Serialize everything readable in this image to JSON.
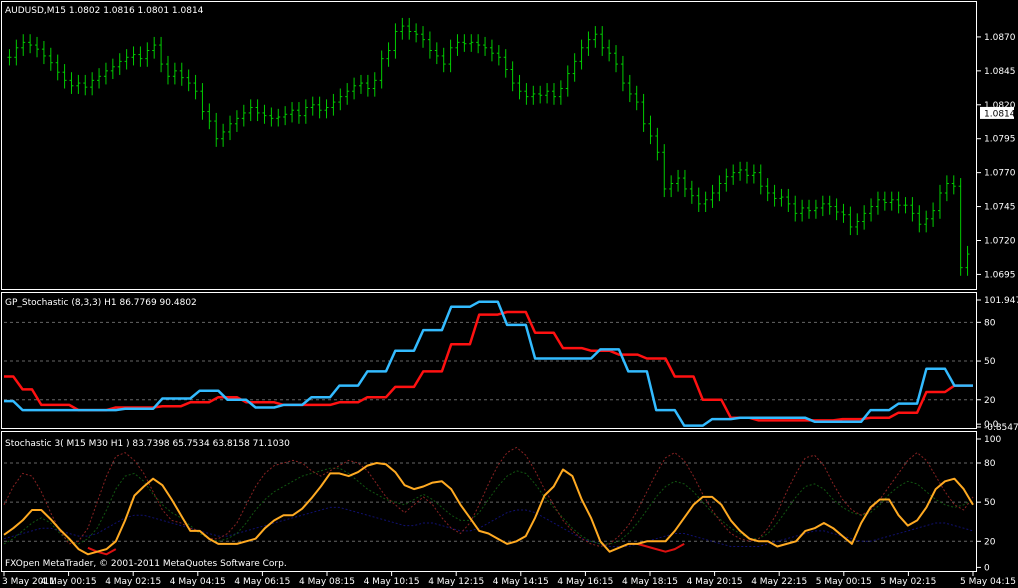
{
  "chart_data": [
    {
      "id": "price",
      "type": "ohlc",
      "title": "AUDUSD,M15  1.0802 1.0816 1.0801 1.0814",
      "ylim": [
        1.0685,
        1.0895
      ],
      "yticks": [
        {
          "value": 1.087,
          "label": "1.0870"
        },
        {
          "value": 1.0845,
          "label": "1.0845"
        },
        {
          "value": 1.082,
          "label": "1.0820"
        },
        {
          "value": 1.0795,
          "label": "1.0795"
        },
        {
          "value": 1.077,
          "label": "1.0770"
        },
        {
          "value": 1.0745,
          "label": "1.0745"
        },
        {
          "value": 1.072,
          "label": "1.0720"
        },
        {
          "value": 1.0695,
          "label": "1.0695"
        }
      ],
      "current_price": {
        "value": 1.0814,
        "label": "1.0814"
      },
      "bar_color": "#00cc00",
      "closes": [
        1.0855,
        1.0862,
        1.0866,
        1.0864,
        1.0861,
        1.0856,
        1.0851,
        1.0844,
        1.0838,
        1.0834,
        1.0836,
        1.0833,
        1.0838,
        1.0841,
        1.0845,
        1.0848,
        1.0852,
        1.0855,
        1.0857,
        1.0854,
        1.086,
        1.0864,
        1.085,
        1.0841,
        1.0845,
        1.084,
        1.0836,
        1.083,
        1.0815,
        1.0808,
        1.0795,
        1.08,
        1.0806,
        1.081,
        1.0814,
        1.0818,
        1.0814,
        1.0812,
        1.081,
        1.0811,
        1.0813,
        1.0816,
        1.0812,
        1.0818,
        1.082,
        1.0816,
        1.0818,
        1.0822,
        1.0826,
        1.083,
        1.0834,
        1.0836,
        1.0832,
        1.0838,
        1.0854,
        1.086,
        1.0874,
        1.0878,
        1.0874,
        1.0872,
        1.0868,
        1.086,
        1.0856,
        1.085,
        1.0862,
        1.0866,
        1.0865,
        1.0866,
        1.0864,
        1.0862,
        1.0858,
        1.0855,
        1.0846,
        1.0836,
        1.083,
        1.0826,
        1.0828,
        1.0827,
        1.083,
        1.0826,
        1.0832,
        1.0843,
        1.0852,
        1.0862,
        1.0868,
        1.0872,
        1.0862,
        1.0858,
        1.085,
        1.0836,
        1.0828,
        1.0822,
        1.0806,
        1.0797,
        1.0785,
        1.0758,
        1.0762,
        1.0766,
        1.0758,
        1.0753,
        1.0747,
        1.075,
        1.0755,
        1.0762,
        1.0767,
        1.077,
        1.0772,
        1.0768,
        1.077,
        1.076,
        1.0755,
        1.0751,
        1.0752,
        1.0747,
        1.074,
        1.0744,
        1.0742,
        1.0744,
        1.0747,
        1.0745,
        1.0741,
        1.0739,
        1.073,
        1.0734,
        1.074,
        1.0745,
        1.075,
        1.0748,
        1.075,
        1.0746,
        1.0746,
        1.074,
        1.0732,
        1.0736,
        1.0742,
        1.0755,
        1.0762,
        1.076,
        1.07,
        1.071
      ]
    },
    {
      "id": "gp_stochastic",
      "type": "line",
      "title": "GP_Stochastic (8,3,3) H1 86.7769 90.4802",
      "ylim": [
        -1.1,
        101.947
      ],
      "yticks": [
        {
          "value": 101.947,
          "label": "101.947"
        },
        {
          "value": 80,
          "label": "80"
        },
        {
          "value": 50,
          "label": "50"
        },
        {
          "value": 20,
          "label": "20"
        },
        {
          "value": 1.1,
          "label": "0.0"
        },
        {
          "value": -1.1,
          "label": "-0.8547"
        }
      ],
      "levels": [
        80,
        50,
        20
      ],
      "series": [
        {
          "color": "#33bbff",
          "values": [
            19,
            19,
            12,
            12,
            12,
            12,
            12,
            12,
            12,
            12,
            12,
            12,
            12,
            13,
            13,
            13,
            13,
            21,
            21,
            21,
            21,
            27,
            27,
            27,
            20,
            20,
            20,
            14,
            14,
            14,
            16,
            16,
            16,
            22,
            22,
            22,
            31,
            31,
            31,
            42,
            42,
            42,
            58,
            58,
            58,
            74,
            74,
            74,
            92,
            92,
            92,
            96,
            96,
            96,
            78,
            78,
            78,
            52,
            52,
            52,
            52,
            52,
            52,
            52,
            59,
            59,
            59,
            42,
            42,
            42,
            12,
            12,
            12,
            0,
            0,
            0,
            5,
            5,
            5,
            6,
            6,
            6,
            6,
            6,
            6,
            6,
            6,
            3,
            3,
            3,
            3,
            3,
            3,
            12,
            12,
            12,
            17,
            17,
            17,
            44,
            44,
            44,
            31,
            31,
            31
          ]
        },
        {
          "color": "#ff1111",
          "values": [
            38,
            38,
            28,
            28,
            16,
            16,
            16,
            16,
            12,
            12,
            12,
            12,
            14,
            14,
            14,
            14,
            14,
            15,
            15,
            15,
            18,
            18,
            18,
            22,
            22,
            22,
            18,
            18,
            18,
            18,
            16,
            16,
            16,
            16,
            16,
            16,
            18,
            18,
            18,
            22,
            22,
            22,
            30,
            30,
            30,
            42,
            42,
            42,
            63,
            63,
            63,
            86,
            86,
            86,
            88,
            88,
            88,
            72,
            72,
            72,
            60,
            60,
            60,
            58,
            58,
            58,
            55,
            55,
            55,
            52,
            52,
            52,
            38,
            38,
            38,
            20,
            20,
            20,
            6,
            6,
            6,
            4,
            4,
            4,
            4,
            4,
            4,
            4,
            4,
            4,
            5,
            5,
            5,
            6,
            6,
            6,
            10,
            10,
            10,
            26,
            26,
            26,
            31,
            31,
            31
          ]
        }
      ]
    },
    {
      "id": "stochastic3",
      "type": "line",
      "title": "Stochastic 3( M15  M30  H1  ) 83.7398 65.7534 63.8158 71.1030",
      "ylim": [
        -2,
        103
      ],
      "yticks": [
        {
          "value": 100,
          "label": "100"
        },
        {
          "value": 80,
          "label": "80"
        },
        {
          "value": 50,
          "label": "50"
        },
        {
          "value": 20,
          "label": "20"
        },
        {
          "value": 0,
          "label": "0"
        }
      ],
      "levels": [
        80,
        50,
        20
      ],
      "x": {
        "labels": [
          "3 May 2011",
          "4 May 00:15",
          "4 May 02:15",
          "4 May 04:15",
          "4 May 06:15",
          "4 May 08:15",
          "4 May 10:15",
          "4 May 12:15",
          "4 May 14:15",
          "4 May 16:15",
          "4 May 18:15",
          "4 May 20:15",
          "4 May 22:15",
          "5 May 00:15",
          "5 May 02:15",
          "5 May 04:15"
        ]
      },
      "series": [
        {
          "color": "#ffaa22",
          "values": [
            25,
            30,
            36,
            44,
            44,
            37,
            29,
            22,
            14,
            10,
            12,
            14,
            20,
            36,
            55,
            62,
            68,
            63,
            52,
            40,
            28,
            28,
            22,
            18,
            18,
            18,
            20,
            22,
            30,
            36,
            40,
            40,
            45,
            53,
            62,
            72,
            72,
            70,
            73,
            78,
            80,
            79,
            73,
            63,
            60,
            62,
            65,
            66,
            60,
            48,
            38,
            28,
            26,
            22,
            18,
            20,
            24,
            38,
            55,
            62,
            75,
            70,
            52,
            38,
            20,
            12,
            15,
            18,
            18,
            20,
            20,
            20,
            28,
            38,
            48,
            54,
            54,
            48,
            36,
            28,
            22,
            20,
            20,
            16,
            18,
            20,
            28,
            30,
            34,
            30,
            24,
            18,
            34,
            46,
            52,
            52,
            40,
            32,
            36,
            46,
            60,
            66,
            68,
            60,
            48
          ]
        },
        {
          "color": "#dd1111",
          "values": [
            null,
            null,
            null,
            null,
            null,
            null,
            null,
            null,
            null,
            15,
            12,
            10,
            14,
            null,
            null,
            null,
            null,
            null,
            null,
            null,
            null,
            null,
            null,
            null,
            null,
            null,
            null,
            null,
            null,
            null,
            null,
            null,
            null,
            null,
            null,
            null,
            null,
            null,
            null,
            null,
            null,
            null,
            null,
            null,
            null,
            null,
            null,
            null,
            null,
            null,
            null,
            null,
            null,
            null,
            null,
            null,
            null,
            null,
            null,
            null,
            null,
            null,
            null,
            null,
            null,
            null,
            null,
            null,
            18,
            16,
            14,
            12,
            14,
            18,
            null,
            null,
            null,
            null,
            null,
            null,
            null,
            null,
            null,
            null,
            null,
            null,
            null,
            null,
            null,
            null,
            null,
            null,
            null,
            null,
            null,
            null,
            null,
            null,
            null,
            null,
            null,
            null,
            null,
            null,
            null
          ]
        },
        {
          "color": "#882222",
          "dashed": true,
          "values": [
            48,
            62,
            72,
            70,
            58,
            42,
            28,
            18,
            20,
            30,
            50,
            70,
            85,
            88,
            82,
            72,
            58,
            44,
            36,
            34,
            30,
            28,
            22,
            22,
            26,
            34,
            48,
            62,
            72,
            78,
            80,
            82,
            80,
            74,
            70,
            74,
            78,
            82,
            80,
            74,
            64,
            54,
            48,
            42,
            48,
            54,
            48,
            38,
            30,
            26,
            34,
            48,
            64,
            78,
            88,
            92,
            86,
            74,
            60,
            48,
            36,
            28,
            22,
            18,
            16,
            18,
            24,
            32,
            44,
            58,
            72,
            84,
            88,
            82,
            70,
            56,
            44,
            34,
            26,
            22,
            20,
            22,
            30,
            42,
            58,
            72,
            84,
            86,
            78,
            64,
            52,
            44,
            40,
            44,
            52,
            62,
            72,
            82,
            88,
            82,
            70,
            58,
            48,
            44,
            54
          ]
        },
        {
          "color": "#115511",
          "dashed": true,
          "values": [
            18,
            22,
            28,
            34,
            38,
            34,
            26,
            20,
            18,
            22,
            30,
            44,
            60,
            70,
            72,
            66,
            56,
            48,
            42,
            38,
            32,
            26,
            22,
            20,
            22,
            26,
            34,
            44,
            52,
            58,
            62,
            66,
            70,
            72,
            74,
            76,
            76,
            72,
            66,
            60,
            56,
            52,
            50,
            48,
            52,
            56,
            52,
            46,
            40,
            36,
            36,
            42,
            52,
            62,
            70,
            74,
            72,
            64,
            54,
            46,
            38,
            30,
            24,
            20,
            18,
            18,
            20,
            26,
            34,
            44,
            54,
            62,
            66,
            64,
            58,
            50,
            42,
            36,
            30,
            26,
            22,
            22,
            26,
            34,
            44,
            54,
            62,
            64,
            60,
            52,
            46,
            42,
            40,
            42,
            48,
            56,
            62,
            66,
            64,
            58,
            52,
            48,
            46,
            48,
            52
          ]
        },
        {
          "color": "#101070",
          "dashed": true,
          "values": [
            22,
            24,
            26,
            28,
            30,
            30,
            28,
            26,
            24,
            24,
            26,
            30,
            34,
            38,
            40,
            40,
            38,
            36,
            34,
            32,
            30,
            28,
            26,
            24,
            24,
            26,
            28,
            30,
            32,
            34,
            36,
            38,
            40,
            42,
            44,
            46,
            46,
            44,
            42,
            40,
            38,
            36,
            34,
            32,
            32,
            34,
            34,
            32,
            30,
            28,
            28,
            30,
            34,
            38,
            42,
            44,
            44,
            42,
            38,
            34,
            30,
            26,
            22,
            20,
            18,
            16,
            16,
            16,
            18,
            20,
            22,
            24,
            26,
            26,
            24,
            22,
            20,
            18,
            16,
            16,
            16,
            16,
            18,
            20,
            22,
            24,
            26,
            28,
            28,
            26,
            24,
            22,
            20,
            20,
            22,
            24,
            26,
            28,
            30,
            32,
            34,
            34,
            32,
            30,
            28
          ]
        }
      ]
    }
  ],
  "footer": {
    "copyright": "FXOpen MetaTrader, © 2001-2011 MetaQuotes Software Corp."
  },
  "colors": {
    "background": "#000000",
    "frame": "#ffffff",
    "level_line": "#666666",
    "grid": "#aaaaaa"
  }
}
